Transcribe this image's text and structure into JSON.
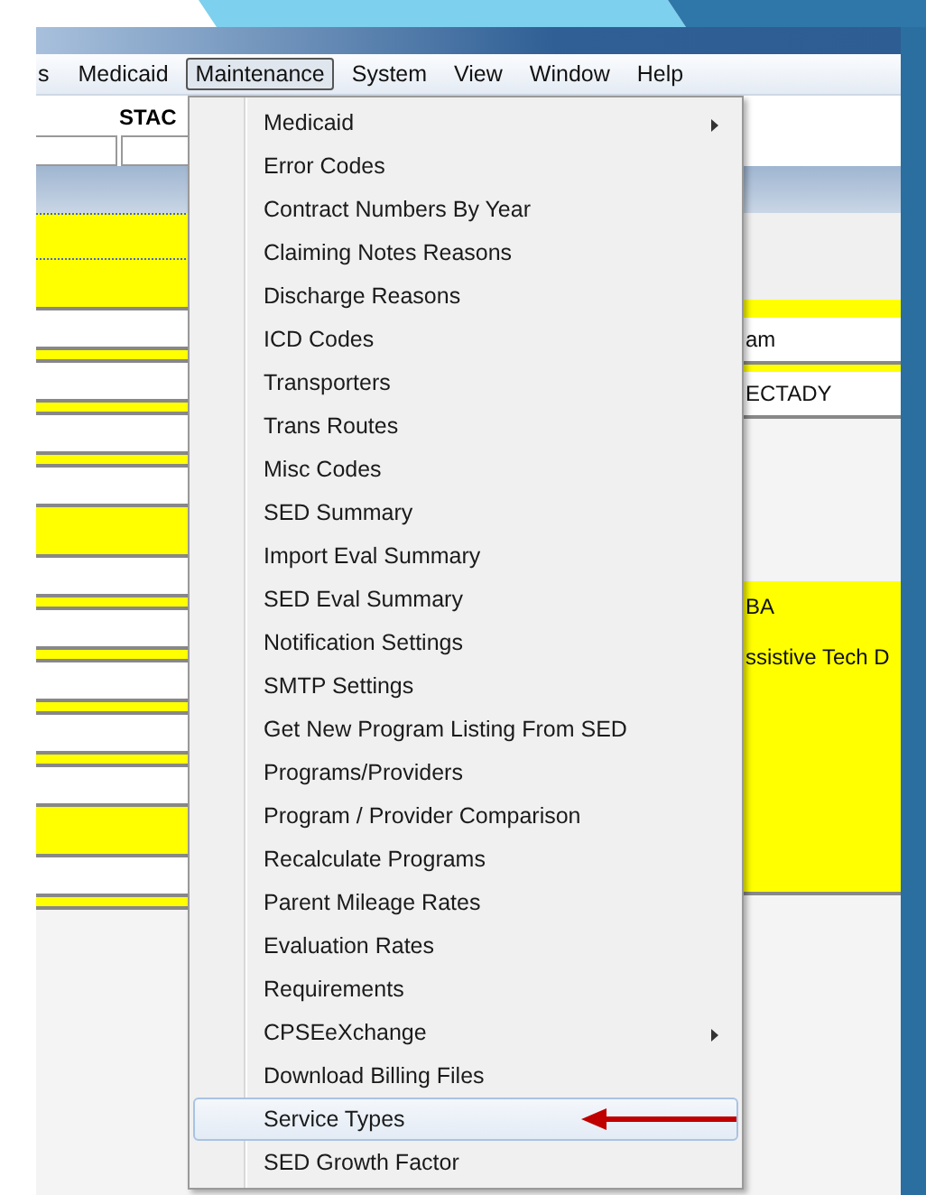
{
  "menu_bar": [
    {
      "label": "s",
      "selected": false
    },
    {
      "label": "Medicaid",
      "selected": false
    },
    {
      "label": "Maintenance",
      "selected": true
    },
    {
      "label": "System",
      "selected": false
    },
    {
      "label": "View",
      "selected": false
    },
    {
      "label": "Window",
      "selected": false
    },
    {
      "label": "Help",
      "selected": false
    }
  ],
  "toolbar": {
    "label": "STAC"
  },
  "form_values": [
    {
      "kind": "white",
      "text": "am"
    },
    {
      "kind": "white",
      "text": "ECTADY"
    },
    {
      "kind": "yellow",
      "text": "BA"
    },
    {
      "kind": "yellow",
      "text": "ssistive Tech D"
    }
  ],
  "dropdown_menu": [
    {
      "label": "Medicaid",
      "kind": "submenu",
      "selected": false
    },
    {
      "label": "Error Codes",
      "kind": "item",
      "selected": false
    },
    {
      "label": "Contract Numbers By Year",
      "kind": "item",
      "selected": false
    },
    {
      "label": "Claiming Notes Reasons",
      "kind": "item",
      "selected": false
    },
    {
      "label": "Discharge Reasons",
      "kind": "item",
      "selected": false
    },
    {
      "label": "ICD Codes",
      "kind": "item",
      "selected": false
    },
    {
      "label": "Transporters",
      "kind": "item",
      "selected": false
    },
    {
      "label": "Trans Routes",
      "kind": "item",
      "selected": false
    },
    {
      "label": "Misc Codes",
      "kind": "item",
      "selected": false
    },
    {
      "label": "SED Summary",
      "kind": "item",
      "selected": false
    },
    {
      "label": "Import Eval Summary",
      "kind": "item",
      "selected": false
    },
    {
      "label": "SED Eval Summary",
      "kind": "item",
      "selected": false
    },
    {
      "label": "Notification Settings",
      "kind": "item",
      "selected": false
    },
    {
      "label": "SMTP Settings",
      "kind": "item",
      "selected": false
    },
    {
      "label": "Get New Program Listing From SED",
      "kind": "item",
      "selected": false
    },
    {
      "label": "Programs/Providers",
      "kind": "item",
      "selected": false
    },
    {
      "label": "Program / Provider Comparison",
      "kind": "item",
      "selected": false
    },
    {
      "label": "Recalculate Programs",
      "kind": "item",
      "selected": false
    },
    {
      "label": "Parent Mileage Rates",
      "kind": "item",
      "selected": false
    },
    {
      "label": "Evaluation Rates",
      "kind": "item",
      "selected": false
    },
    {
      "label": "Requirements",
      "kind": "item",
      "selected": false
    },
    {
      "label": "CPSEeXchange",
      "kind": "submenu",
      "selected": false
    },
    {
      "label": "Download Billing Files",
      "kind": "item",
      "selected": false
    },
    {
      "label": "Service Types",
      "kind": "item",
      "selected": true
    },
    {
      "label": "SED Growth Factor",
      "kind": "item",
      "selected": false
    }
  ]
}
